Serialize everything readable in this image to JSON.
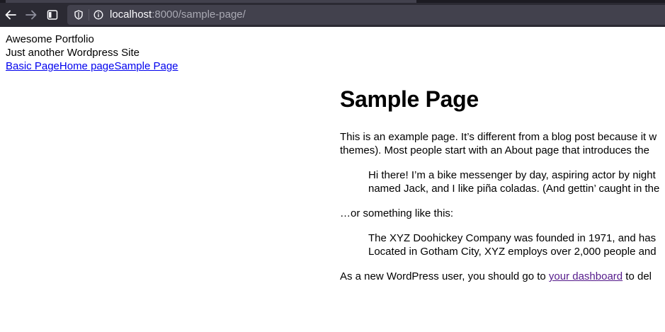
{
  "browser": {
    "url_host": "localhost",
    "url_rest": ":8000/sample-page/",
    "icons": {
      "back": "arrow-left-icon",
      "forward": "arrow-right-icon",
      "sidebar": "sidebar-toggle-icon",
      "tracking": "shield-icon",
      "site_info": "info-icon"
    }
  },
  "site": {
    "title": "Awesome Portfolio",
    "description": "Just another Wordpress Site",
    "nav": [
      {
        "label": "Basic Page"
      },
      {
        "label": "Home page"
      },
      {
        "label": "Sample Page"
      }
    ]
  },
  "page": {
    "title": "Sample Page",
    "intro_line1": "This is an example page. It’s different from a blog post because it w",
    "intro_line2": "themes). Most people start with an About page that introduces the",
    "quote1_line1": "Hi there! I’m a bike messenger by day, aspiring actor by night",
    "quote1_line2": "named Jack, and I like piña coladas. (And gettin’ caught in the",
    "between": "…or something like this:",
    "quote2_line1": "The XYZ Doohickey Company was founded in 1971, and has",
    "quote2_line2": "Located in Gotham City, XYZ employs over 2,000 people and",
    "closing_before": "As a new WordPress user, you should go to ",
    "closing_link": "your dashboard",
    "closing_after": " to del"
  },
  "colors": {
    "chrome_bg": "#2b2a33",
    "urlbar_bg": "#42414d",
    "link": "#0000ee",
    "visited_link": "#551a8b"
  }
}
